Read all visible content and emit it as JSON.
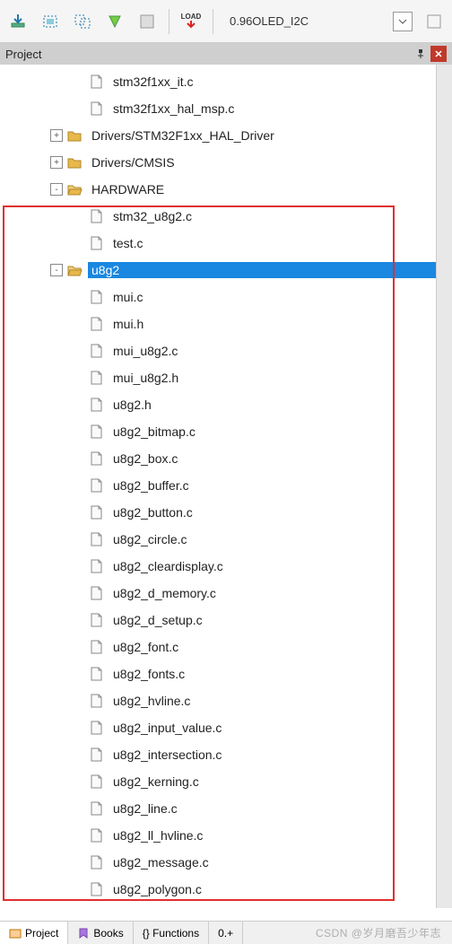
{
  "toolbar": {
    "load_label": "LOAD",
    "target": "0.96OLED_I2C"
  },
  "panel": {
    "title": "Project"
  },
  "tree": [
    {
      "indent": 3,
      "exp": "",
      "type": "file",
      "label": "stm32f1xx_it.c",
      "sel": false
    },
    {
      "indent": 3,
      "exp": "",
      "type": "file",
      "label": "stm32f1xx_hal_msp.c",
      "sel": false
    },
    {
      "indent": 2,
      "exp": "+",
      "type": "folder",
      "label": "Drivers/STM32F1xx_HAL_Driver",
      "sel": false
    },
    {
      "indent": 2,
      "exp": "+",
      "type": "folder",
      "label": "Drivers/CMSIS",
      "sel": false
    },
    {
      "indent": 2,
      "exp": "-",
      "type": "folder-open",
      "label": "HARDWARE",
      "sel": false
    },
    {
      "indent": 3,
      "exp": "",
      "type": "file",
      "label": "stm32_u8g2.c",
      "sel": false
    },
    {
      "indent": 3,
      "exp": "",
      "type": "file",
      "label": "test.c",
      "sel": false
    },
    {
      "indent": 2,
      "exp": "-",
      "type": "folder-open",
      "label": "u8g2",
      "sel": true
    },
    {
      "indent": 3,
      "exp": "",
      "type": "file",
      "label": "mui.c",
      "sel": false
    },
    {
      "indent": 3,
      "exp": "",
      "type": "file",
      "label": "mui.h",
      "sel": false
    },
    {
      "indent": 3,
      "exp": "",
      "type": "file",
      "label": "mui_u8g2.c",
      "sel": false
    },
    {
      "indent": 3,
      "exp": "",
      "type": "file",
      "label": "mui_u8g2.h",
      "sel": false
    },
    {
      "indent": 3,
      "exp": "",
      "type": "file",
      "label": "u8g2.h",
      "sel": false
    },
    {
      "indent": 3,
      "exp": "",
      "type": "file",
      "label": "u8g2_bitmap.c",
      "sel": false
    },
    {
      "indent": 3,
      "exp": "",
      "type": "file",
      "label": "u8g2_box.c",
      "sel": false
    },
    {
      "indent": 3,
      "exp": "",
      "type": "file",
      "label": "u8g2_buffer.c",
      "sel": false
    },
    {
      "indent": 3,
      "exp": "",
      "type": "file",
      "label": "u8g2_button.c",
      "sel": false
    },
    {
      "indent": 3,
      "exp": "",
      "type": "file",
      "label": "u8g2_circle.c",
      "sel": false
    },
    {
      "indent": 3,
      "exp": "",
      "type": "file",
      "label": "u8g2_cleardisplay.c",
      "sel": false
    },
    {
      "indent": 3,
      "exp": "",
      "type": "file",
      "label": "u8g2_d_memory.c",
      "sel": false
    },
    {
      "indent": 3,
      "exp": "",
      "type": "file",
      "label": "u8g2_d_setup.c",
      "sel": false
    },
    {
      "indent": 3,
      "exp": "",
      "type": "file",
      "label": "u8g2_font.c",
      "sel": false
    },
    {
      "indent": 3,
      "exp": "",
      "type": "file",
      "label": "u8g2_fonts.c",
      "sel": false
    },
    {
      "indent": 3,
      "exp": "",
      "type": "file",
      "label": "u8g2_hvline.c",
      "sel": false
    },
    {
      "indent": 3,
      "exp": "",
      "type": "file",
      "label": "u8g2_input_value.c",
      "sel": false
    },
    {
      "indent": 3,
      "exp": "",
      "type": "file",
      "label": "u8g2_intersection.c",
      "sel": false
    },
    {
      "indent": 3,
      "exp": "",
      "type": "file",
      "label": "u8g2_kerning.c",
      "sel": false
    },
    {
      "indent": 3,
      "exp": "",
      "type": "file",
      "label": "u8g2_line.c",
      "sel": false
    },
    {
      "indent": 3,
      "exp": "",
      "type": "file",
      "label": "u8g2_ll_hvline.c",
      "sel": false
    },
    {
      "indent": 3,
      "exp": "",
      "type": "file",
      "label": "u8g2_message.c",
      "sel": false
    },
    {
      "indent": 3,
      "exp": "",
      "type": "file",
      "label": "u8g2_polygon.c",
      "sel": false
    }
  ],
  "tabs": [
    {
      "label": "Project",
      "active": true
    },
    {
      "label": "Books",
      "active": false
    },
    {
      "label": "{} Functions",
      "active": false
    },
    {
      "label": "0.+",
      "active": false
    }
  ],
  "watermark": "CSDN @岁月磨吾少年志"
}
